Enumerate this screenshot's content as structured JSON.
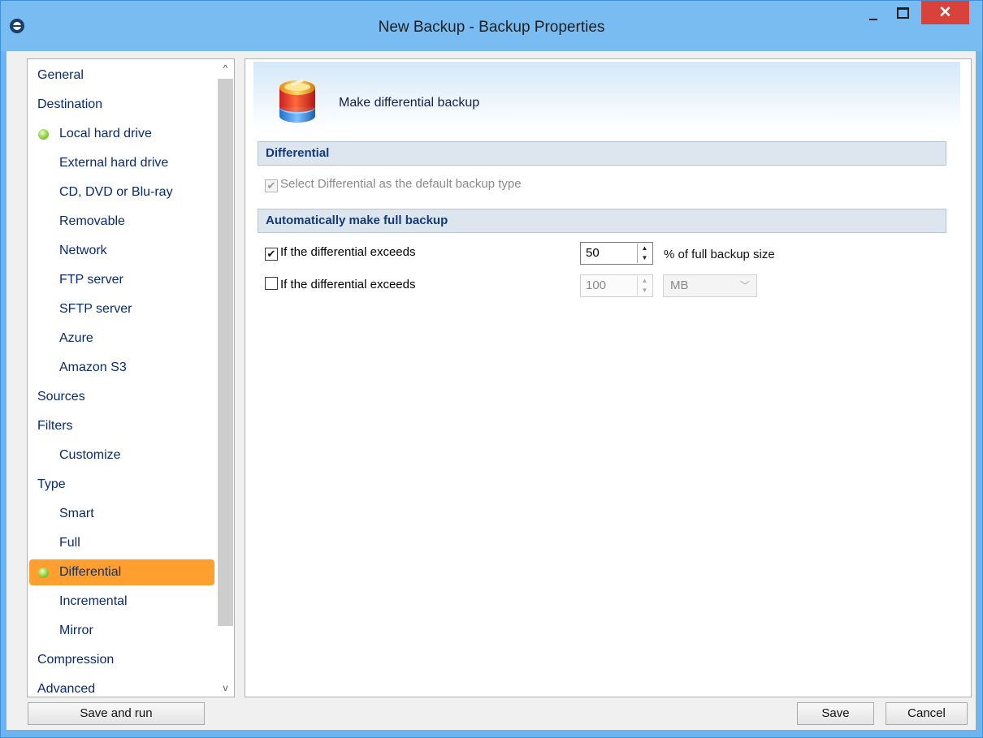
{
  "window": {
    "title": "New Backup - Backup Properties",
    "minimize": "–",
    "maximize": "□",
    "close": "✕",
    "accent": "#78bcf2",
    "close_color": "#d9413b"
  },
  "nav": {
    "items": [
      {
        "label": "General",
        "level": 0,
        "dot": false,
        "selected": false
      },
      {
        "label": "Destination",
        "level": 0,
        "dot": false,
        "selected": false
      },
      {
        "label": "Local hard drive",
        "level": 1,
        "dot": true,
        "selected": false
      },
      {
        "label": "External hard drive",
        "level": 1,
        "dot": false,
        "selected": false
      },
      {
        "label": "CD, DVD or Blu-ray",
        "level": 1,
        "dot": false,
        "selected": false
      },
      {
        "label": "Removable",
        "level": 1,
        "dot": false,
        "selected": false
      },
      {
        "label": "Network",
        "level": 1,
        "dot": false,
        "selected": false
      },
      {
        "label": "FTP server",
        "level": 1,
        "dot": false,
        "selected": false
      },
      {
        "label": "SFTP server",
        "level": 1,
        "dot": false,
        "selected": false
      },
      {
        "label": "Azure",
        "level": 1,
        "dot": false,
        "selected": false
      },
      {
        "label": "Amazon S3",
        "level": 1,
        "dot": false,
        "selected": false
      },
      {
        "label": "Sources",
        "level": 0,
        "dot": false,
        "selected": false
      },
      {
        "label": "Filters",
        "level": 0,
        "dot": false,
        "selected": false
      },
      {
        "label": "Customize",
        "level": 1,
        "dot": false,
        "selected": false
      },
      {
        "label": "Type",
        "level": 0,
        "dot": false,
        "selected": false
      },
      {
        "label": "Smart",
        "level": 1,
        "dot": false,
        "selected": false
      },
      {
        "label": "Full",
        "level": 1,
        "dot": false,
        "selected": false
      },
      {
        "label": "Differential",
        "level": 1,
        "dot": true,
        "selected": true
      },
      {
        "label": "Incremental",
        "level": 1,
        "dot": false,
        "selected": false
      },
      {
        "label": "Mirror",
        "level": 1,
        "dot": false,
        "selected": false
      },
      {
        "label": "Compression",
        "level": 0,
        "dot": false,
        "selected": false
      },
      {
        "label": "Advanced",
        "level": 0,
        "dot": false,
        "selected": false
      }
    ],
    "scroll_up": "^",
    "scroll_down": "v",
    "selected_color": "#ff9f2f"
  },
  "panel": {
    "header_text": "Make differential backup",
    "section1_title": "Differential",
    "default_type_label": "Select Differential as the default backup type",
    "default_type_checked": true,
    "section2_title": "Automatically make full backup",
    "row1": {
      "label": "If the differential exceeds",
      "checked": true,
      "value": "50",
      "unit": "% of full backup size"
    },
    "row2": {
      "label": "If the differential exceeds",
      "checked": false,
      "value": "100",
      "unit_select": "MB"
    }
  },
  "footer": {
    "save_and_run": "Save and run",
    "save": "Save",
    "cancel": "Cancel"
  }
}
